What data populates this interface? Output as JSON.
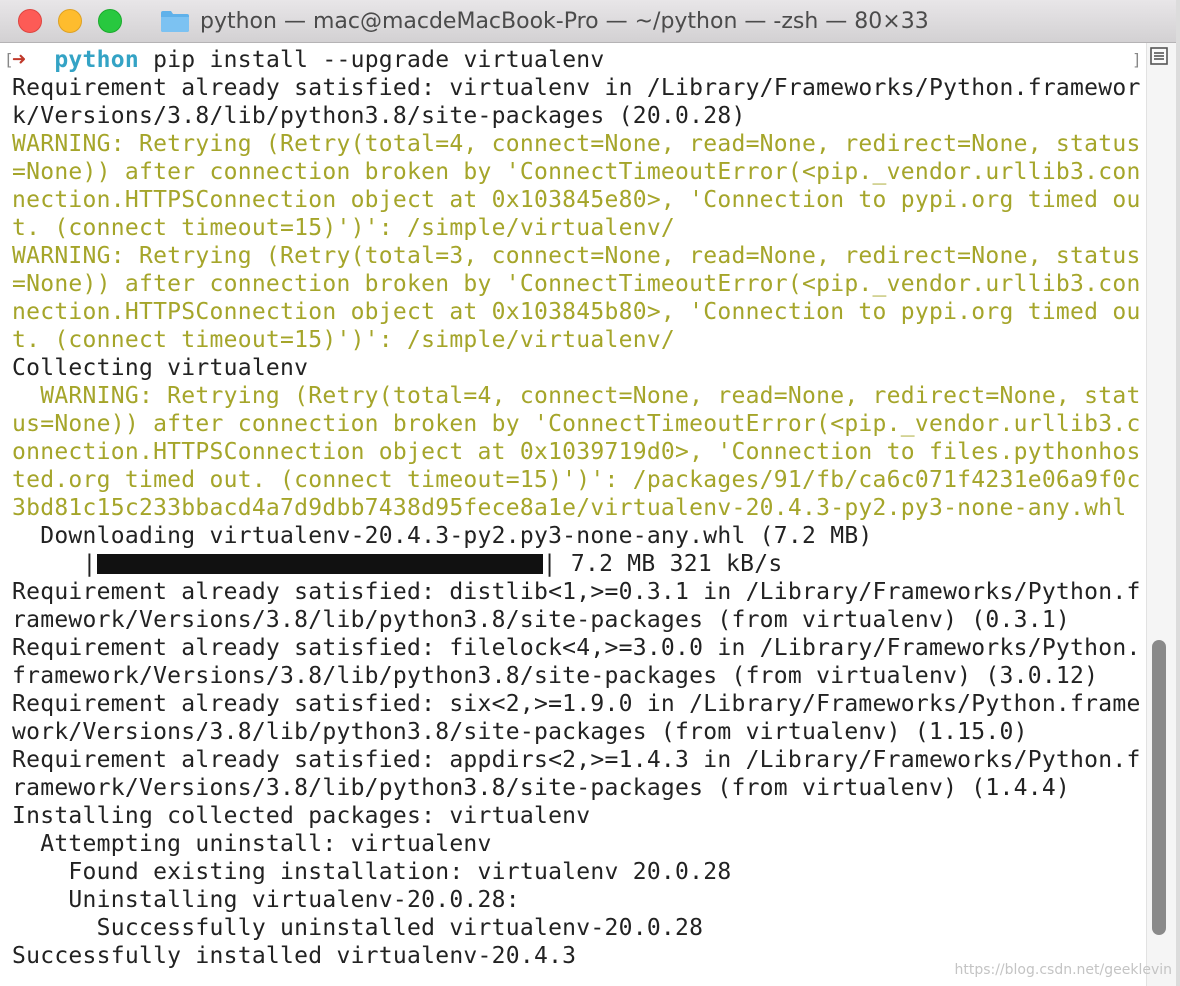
{
  "window": {
    "title": "python — mac@macdeMacBook-Pro — ~/python — -zsh — 80×33"
  },
  "terminal": {
    "prompt": {
      "arrow": "➜",
      "dir": "python",
      "command": " pip install --upgrade virtualenv"
    },
    "lines": [
      {
        "text": "Requirement already satisfied: virtualenv in /Library/Frameworks/Python.framewor",
        "style": "normal"
      },
      {
        "text": "k/Versions/3.8/lib/python3.8/site-packages (20.0.28)",
        "style": "normal"
      },
      {
        "text": "WARNING: Retrying (Retry(total=4, connect=None, read=None, redirect=None, status",
        "style": "warn"
      },
      {
        "text": "=None)) after connection broken by 'ConnectTimeoutError(<pip._vendor.urllib3.con",
        "style": "warn"
      },
      {
        "text": "nection.HTTPSConnection object at 0x103845e80>, 'Connection to pypi.org timed ou",
        "style": "warn"
      },
      {
        "text": "t. (connect timeout=15)')': /simple/virtualenv/",
        "style": "warn"
      },
      {
        "text": "WARNING: Retrying (Retry(total=3, connect=None, read=None, redirect=None, status",
        "style": "warn"
      },
      {
        "text": "=None)) after connection broken by 'ConnectTimeoutError(<pip._vendor.urllib3.con",
        "style": "warn"
      },
      {
        "text": "nection.HTTPSConnection object at 0x103845b80>, 'Connection to pypi.org timed ou",
        "style": "warn"
      },
      {
        "text": "t. (connect timeout=15)')': /simple/virtualenv/",
        "style": "warn"
      },
      {
        "text": "Collecting virtualenv",
        "style": "normal"
      },
      {
        "text": "  WARNING: Retrying (Retry(total=4, connect=None, read=None, redirect=None, stat",
        "style": "warn"
      },
      {
        "text": "us=None)) after connection broken by 'ConnectTimeoutError(<pip._vendor.urllib3.c",
        "style": "warn"
      },
      {
        "text": "onnection.HTTPSConnection object at 0x1039719d0>, 'Connection to files.pythonhos",
        "style": "warn"
      },
      {
        "text": "ted.org timed out. (connect timeout=15)')': /packages/91/fb/ca6c071f4231e06a9f0c",
        "style": "warn"
      },
      {
        "text": "3bd81c15c233bbacd4a7d9dbb7438d95fece8a1e/virtualenv-20.4.3-py2.py3-none-any.whl",
        "style": "warn"
      },
      {
        "text": "  Downloading virtualenv-20.4.3-py2.py3-none-any.whl (7.2 MB)",
        "style": "normal"
      },
      {
        "text": "PROGRESS",
        "style": "bar"
      },
      {
        "text": "Requirement already satisfied: distlib<1,>=0.3.1 in /Library/Frameworks/Python.f",
        "style": "normal"
      },
      {
        "text": "ramework/Versions/3.8/lib/python3.8/site-packages (from virtualenv) (0.3.1)",
        "style": "normal"
      },
      {
        "text": "Requirement already satisfied: filelock<4,>=3.0.0 in /Library/Frameworks/Python.",
        "style": "normal"
      },
      {
        "text": "framework/Versions/3.8/lib/python3.8/site-packages (from virtualenv) (3.0.12)",
        "style": "normal"
      },
      {
        "text": "Requirement already satisfied: six<2,>=1.9.0 in /Library/Frameworks/Python.frame",
        "style": "normal"
      },
      {
        "text": "work/Versions/3.8/lib/python3.8/site-packages (from virtualenv) (1.15.0)",
        "style": "normal"
      },
      {
        "text": "Requirement already satisfied: appdirs<2,>=1.4.3 in /Library/Frameworks/Python.f",
        "style": "normal"
      },
      {
        "text": "ramework/Versions/3.8/lib/python3.8/site-packages (from virtualenv) (1.4.4)",
        "style": "normal"
      },
      {
        "text": "Installing collected packages: virtualenv",
        "style": "normal"
      },
      {
        "text": "  Attempting uninstall: virtualenv",
        "style": "normal"
      },
      {
        "text": "    Found existing installation: virtualenv 20.0.28",
        "style": "normal"
      },
      {
        "text": "    Uninstalling virtualenv-20.0.28:",
        "style": "normal"
      },
      {
        "text": "      Successfully uninstalled virtualenv-20.0.28",
        "style": "normal"
      },
      {
        "text": "Successfully installed virtualenv-20.4.3",
        "style": "normal"
      }
    ],
    "progress": {
      "indent": "     |",
      "end": "| 7.2 MB 321 kB/s",
      "fraction": 1.0
    }
  },
  "colors": {
    "warning": "#a5a52a",
    "prompt_arrow": "#c0392b",
    "prompt_dir": "#34a3c5"
  },
  "watermark": "https://blog.csdn.net/geeklevin"
}
